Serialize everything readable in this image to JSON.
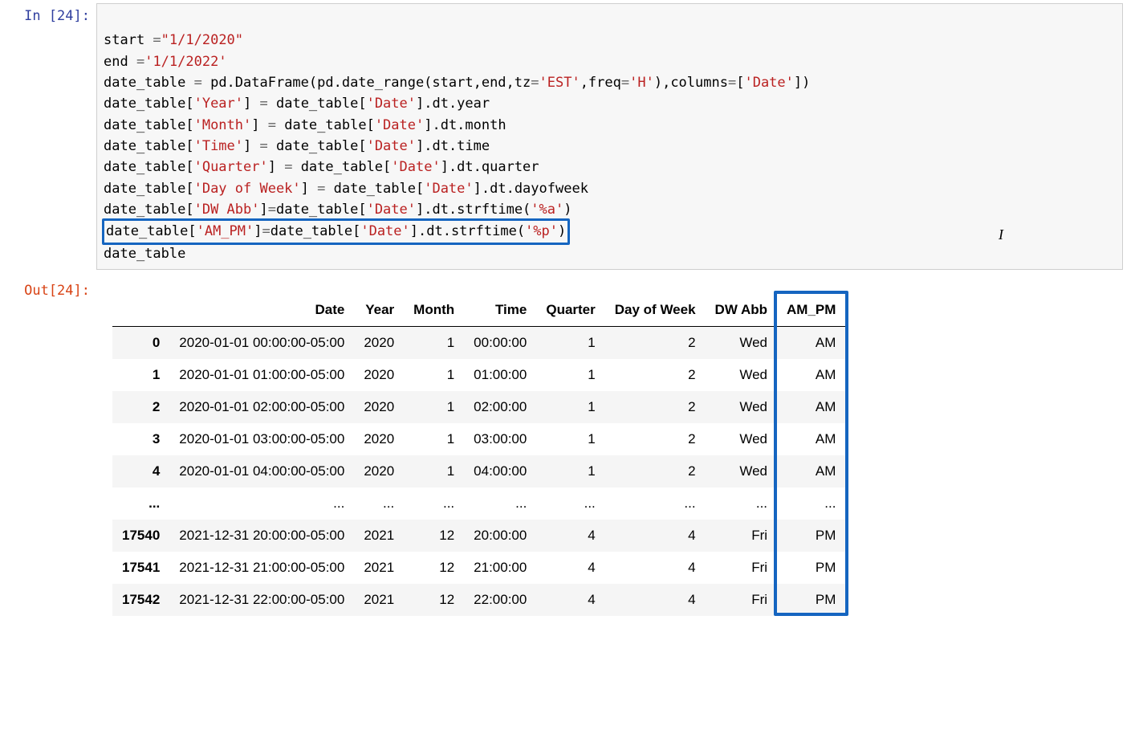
{
  "cell": {
    "exec_count": "24",
    "in_label": "In [24]:",
    "out_label": "Out[24]:",
    "code": {
      "l1a": "start ",
      "l1b": "=",
      "l1c": "\"1/1/2020\"",
      "l2a": "end ",
      "l2b": "=",
      "l2c": "'1/1/2022'",
      "l3a": "date_table ",
      "l3b": "=",
      "l3c": " pd.DataFrame(pd.date_range(start,end,tz",
      "l3d": "=",
      "l3e": "'EST'",
      "l3f": ",freq",
      "l3g": "=",
      "l3h": "'H'",
      "l3i": "),columns",
      "l3j": "=",
      "l3k": "[",
      "l3l": "'Date'",
      "l3m": "])",
      "l4a": "date_table[",
      "l4b": "'Year'",
      "l4c": "] ",
      "l4d": "=",
      "l4e": " date_table[",
      "l4f": "'Date'",
      "l4g": "].dt.year",
      "l5a": "date_table[",
      "l5b": "'Month'",
      "l5c": "] ",
      "l5d": "=",
      "l5e": " date_table[",
      "l5f": "'Date'",
      "l5g": "].dt.month",
      "l6a": "date_table[",
      "l6b": "'Time'",
      "l6c": "] ",
      "l6d": "=",
      "l6e": " date_table[",
      "l6f": "'Date'",
      "l6g": "].dt.time",
      "l7a": "date_table[",
      "l7b": "'Quarter'",
      "l7c": "] ",
      "l7d": "=",
      "l7e": " date_table[",
      "l7f": "'Date'",
      "l7g": "].dt.quarter",
      "l8a": "date_table[",
      "l8b": "'Day of Week'",
      "l8c": "] ",
      "l8d": "=",
      "l8e": " date_table[",
      "l8f": "'Date'",
      "l8g": "].dt.dayofweek",
      "l9a": "date_table[",
      "l9b": "'DW Abb'",
      "l9c": "]",
      "l9d": "=",
      "l9e": "date_table[",
      "l9f": "'Date'",
      "l9g": "].dt.strftime(",
      "l9h": "'%a'",
      "l9i": ")",
      "l10a": "date_table[",
      "l10b": "'AM_PM'",
      "l10c": "]",
      "l10d": "=",
      "l10e": "date_table[",
      "l10f": "'Date'",
      "l10g": "].dt.strftime(",
      "l10h": "'%p'",
      "l10i": ")",
      "l11": "date_table"
    }
  },
  "table": {
    "columns": [
      "",
      "Date",
      "Year",
      "Month",
      "Time",
      "Quarter",
      "Day of Week",
      "DW Abb",
      "AM_PM"
    ],
    "rows": [
      {
        "idx": "0",
        "Date": "2020-01-01 00:00:00-05:00",
        "Year": "2020",
        "Month": "1",
        "Time": "00:00:00",
        "Quarter": "1",
        "DayOfWeek": "2",
        "DWAbb": "Wed",
        "AMPM": "AM"
      },
      {
        "idx": "1",
        "Date": "2020-01-01 01:00:00-05:00",
        "Year": "2020",
        "Month": "1",
        "Time": "01:00:00",
        "Quarter": "1",
        "DayOfWeek": "2",
        "DWAbb": "Wed",
        "AMPM": "AM"
      },
      {
        "idx": "2",
        "Date": "2020-01-01 02:00:00-05:00",
        "Year": "2020",
        "Month": "1",
        "Time": "02:00:00",
        "Quarter": "1",
        "DayOfWeek": "2",
        "DWAbb": "Wed",
        "AMPM": "AM"
      },
      {
        "idx": "3",
        "Date": "2020-01-01 03:00:00-05:00",
        "Year": "2020",
        "Month": "1",
        "Time": "03:00:00",
        "Quarter": "1",
        "DayOfWeek": "2",
        "DWAbb": "Wed",
        "AMPM": "AM"
      },
      {
        "idx": "4",
        "Date": "2020-01-01 04:00:00-05:00",
        "Year": "2020",
        "Month": "1",
        "Time": "04:00:00",
        "Quarter": "1",
        "DayOfWeek": "2",
        "DWAbb": "Wed",
        "AMPM": "AM"
      },
      {
        "idx": "...",
        "Date": "...",
        "Year": "...",
        "Month": "...",
        "Time": "...",
        "Quarter": "...",
        "DayOfWeek": "...",
        "DWAbb": "...",
        "AMPM": "..."
      },
      {
        "idx": "17540",
        "Date": "2021-12-31 20:00:00-05:00",
        "Year": "2021",
        "Month": "12",
        "Time": "20:00:00",
        "Quarter": "4",
        "DayOfWeek": "4",
        "DWAbb": "Fri",
        "AMPM": "PM"
      },
      {
        "idx": "17541",
        "Date": "2021-12-31 21:00:00-05:00",
        "Year": "2021",
        "Month": "12",
        "Time": "21:00:00",
        "Quarter": "4",
        "DayOfWeek": "4",
        "DWAbb": "Fri",
        "AMPM": "PM"
      },
      {
        "idx": "17542",
        "Date": "2021-12-31 22:00:00-05:00",
        "Year": "2021",
        "Month": "12",
        "Time": "22:00:00",
        "Quarter": "4",
        "DayOfWeek": "4",
        "DWAbb": "Fri",
        "AMPM": "PM"
      }
    ]
  },
  "cursor_char": "I"
}
